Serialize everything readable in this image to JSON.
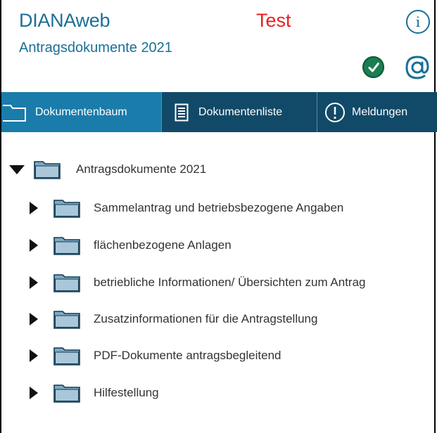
{
  "header": {
    "app_title": "DIANAweb",
    "env_label": "Test",
    "subtitle": "Antragsdokumente 2021",
    "info_glyph": "i",
    "at_glyph": "@",
    "status_icon": "checkmark-ok-icon",
    "colors": {
      "brand": "#1b6f95",
      "env": "#e8201f",
      "ok": "#1b7d52"
    }
  },
  "tabs": [
    {
      "label": "Dokumentenbaum",
      "icon": "folder-outline-icon",
      "active": true
    },
    {
      "label": "Dokumentenliste",
      "icon": "document-list-icon",
      "active": false
    },
    {
      "label": "Meldungen",
      "icon": "exclamation-circle-icon",
      "active": false
    }
  ],
  "tree": {
    "root": {
      "label": "Antragsdokumente 2021",
      "expanded": true,
      "icon": "folder-icon"
    },
    "children": [
      {
        "label": "Sammelantrag und betriebsbezogene Angaben",
        "expanded": false,
        "icon": "folder-icon"
      },
      {
        "label": "flächenbezogene Anlagen",
        "expanded": false,
        "icon": "folder-icon"
      },
      {
        "label": "betriebliche Informationen/ Übersichten zum Antrag",
        "expanded": false,
        "icon": "folder-icon"
      },
      {
        "label": "Zusatzinformationen für die Antragstellung",
        "expanded": false,
        "icon": "folder-icon"
      },
      {
        "label": "PDF-Dokumente antragsbegleitend",
        "expanded": false,
        "icon": "folder-icon"
      },
      {
        "label": "Hilfestellung",
        "expanded": false,
        "icon": "folder-icon"
      }
    ]
  }
}
